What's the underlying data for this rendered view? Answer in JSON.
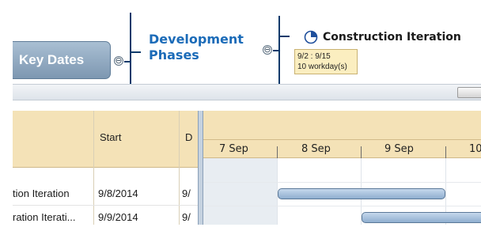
{
  "mindmap": {
    "root_node_label": "Key Dates",
    "phase_node_line1": "Development",
    "phase_node_line2": "Phases",
    "task_node_label": "Construction Iteration",
    "task_tooltip_dates": "9/2 : 9/15",
    "task_tooltip_duration": "10 workday(s)",
    "collapse_symbol": "⊖"
  },
  "grid": {
    "columns": [
      "",
      "Start",
      "D"
    ],
    "rows": [
      {
        "name": "tion Iteration",
        "start": "9/8/2014",
        "duration": "9/"
      },
      {
        "name": "ration Iterati...",
        "start": "9/9/2014",
        "duration": "9/"
      }
    ]
  },
  "timeline": {
    "days": [
      "7 Sep",
      "8 Sep",
      "9 Sep",
      "10"
    ]
  },
  "colors": {
    "header_bg": "#f4e2b7",
    "node_blue": "#1b6bb8",
    "bar_fill": "#8faecf",
    "tooltip_bg": "#fbeec0"
  },
  "icons": [
    "pie-progress-icon",
    "collapse-icon"
  ]
}
